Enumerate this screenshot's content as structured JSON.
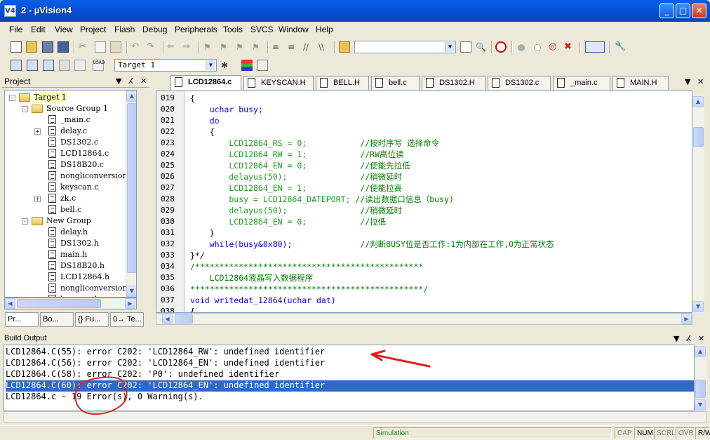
{
  "window": {
    "title": "2 - µVision4",
    "icon_label": "V4"
  },
  "menu": [
    "File",
    "Edit",
    "View",
    "Project",
    "Flash",
    "Debug",
    "Peripherals",
    "Tools",
    "SVCS",
    "Window",
    "Help"
  ],
  "toolbar": {
    "find_combo_value": "",
    "target_combo_value": "Target 1"
  },
  "project_panel": {
    "title": "Project",
    "tree": [
      {
        "label": "Target 1",
        "level": 0,
        "type": "target",
        "expand": "-"
      },
      {
        "label": "Source Group 1",
        "level": 1,
        "type": "folder",
        "expand": "-"
      },
      {
        "label": "_main.c",
        "level": 2,
        "type": "file",
        "expand": ""
      },
      {
        "label": "delay.c",
        "level": 2,
        "type": "file",
        "expand": "+"
      },
      {
        "label": "DS1302.c",
        "level": 2,
        "type": "file",
        "expand": ""
      },
      {
        "label": "LCD12864.c",
        "level": 2,
        "type": "file",
        "expand": ""
      },
      {
        "label": "DS18B20.c",
        "level": 2,
        "type": "file",
        "expand": ""
      },
      {
        "label": "nongliconversion.c",
        "level": 2,
        "type": "file",
        "expand": ""
      },
      {
        "label": "keyscan.c",
        "level": 2,
        "type": "file",
        "expand": ""
      },
      {
        "label": "zk.c",
        "level": 2,
        "type": "file",
        "expand": "+"
      },
      {
        "label": "bell.c",
        "level": 2,
        "type": "file",
        "expand": ""
      },
      {
        "label": "New Group",
        "level": 1,
        "type": "folder",
        "expand": "-"
      },
      {
        "label": "delay.h",
        "level": 2,
        "type": "file",
        "expand": ""
      },
      {
        "label": "DS1302.h",
        "level": 2,
        "type": "file",
        "expand": ""
      },
      {
        "label": "main.h",
        "level": 2,
        "type": "file",
        "expand": ""
      },
      {
        "label": "DS18B20.h",
        "level": 2,
        "type": "file",
        "expand": ""
      },
      {
        "label": "LCD12864.h",
        "level": 2,
        "type": "file",
        "expand": ""
      },
      {
        "label": "nongliconversion.h",
        "level": 2,
        "type": "file",
        "expand": ""
      },
      {
        "label": "keyscan.h",
        "level": 2,
        "type": "file",
        "expand": ""
      }
    ],
    "bottom_tabs": [
      "Pr...",
      "Bo...",
      "{} Fu...",
      "0→ Te..."
    ]
  },
  "editor": {
    "tabs": [
      {
        "label": "LCD12864.c",
        "active": true
      },
      {
        "label": "KEYSCAN.H",
        "active": false
      },
      {
        "label": "BELL.H",
        "active": false
      },
      {
        "label": "bell.c",
        "active": false
      },
      {
        "label": "DS1302.H",
        "active": false
      },
      {
        "label": "DS1302.c",
        "active": false
      },
      {
        "label": "_main.c",
        "active": false
      },
      {
        "label": "MAIN.H",
        "active": false
      }
    ],
    "lines": [
      {
        "no": "019",
        "code": "{",
        "comment": ""
      },
      {
        "no": "020",
        "code": "    uchar busy;",
        "comment": ""
      },
      {
        "no": "021",
        "code": "    do",
        "comment": ""
      },
      {
        "no": "022",
        "code": "    {",
        "comment": ""
      },
      {
        "no": "023",
        "code": "        LCD12864_RS = 0;           ",
        "comment": "//按时序写 选择命令"
      },
      {
        "no": "024",
        "code": "        LCD12864_RW = 1;           ",
        "comment": "//RW高位读"
      },
      {
        "no": "025",
        "code": "        LCD12864_EN = 0;           ",
        "comment": "//使能先拉低"
      },
      {
        "no": "026",
        "code": "        delayus(50);               ",
        "comment": "//稍微延时"
      },
      {
        "no": "027",
        "code": "        LCD12864_EN = 1;           ",
        "comment": "//使能拉高"
      },
      {
        "no": "028",
        "code": "        busy = LCD12864_DATEPORT; ",
        "comment": "//读出数据口信息（busy)"
      },
      {
        "no": "029",
        "code": "        delayus(50);               ",
        "comment": "//稍微延时"
      },
      {
        "no": "030",
        "code": "        LCD12864_EN = 0;           ",
        "comment": "//拉低"
      },
      {
        "no": "031",
        "code": "    }",
        "comment": ""
      },
      {
        "no": "032",
        "code": "    while(busy&0x80);              ",
        "comment": "//判断BUSY位是否工作:1为内部在工作,0为正常状态"
      },
      {
        "no": "033",
        "code": "}*/",
        "comment": ""
      },
      {
        "no": "034",
        "code": "",
        "comment": "/***********************************************"
      },
      {
        "no": "035",
        "code": "",
        "comment": "    LCD12864液晶写入数据程序"
      },
      {
        "no": "036",
        "code": "",
        "comment": "************************************************/"
      },
      {
        "no": "037",
        "code": "void writedat_12864(uchar dat)",
        "comment": ""
      },
      {
        "no": "038",
        "code": "{",
        "comment": ""
      }
    ]
  },
  "build_output": {
    "title": "Build Output",
    "lines": [
      {
        "text": "LCD12864.C(55): error C202: 'LCD12864_RW': undefined identifier",
        "selected": false
      },
      {
        "text": "LCD12864.C(56): error C202: 'LCD12864_EN': undefined identifier",
        "selected": false
      },
      {
        "text": "LCD12864.C(58): error C202: 'P0': undefined identifier",
        "selected": false
      },
      {
        "text": "LCD12864.C(60): error C202: 'LCD12864_EN': undefined identifier",
        "selected": true
      },
      {
        "text": "LCD12864.c - 19 Error(s), 0 Warning(s).",
        "selected": false
      }
    ],
    "annotation_color": "#e02020"
  },
  "status_bar": {
    "mode": "Simulation",
    "indicators": [
      "CAP",
      "NUM",
      "SCRL",
      "OVR",
      "R/W"
    ]
  }
}
